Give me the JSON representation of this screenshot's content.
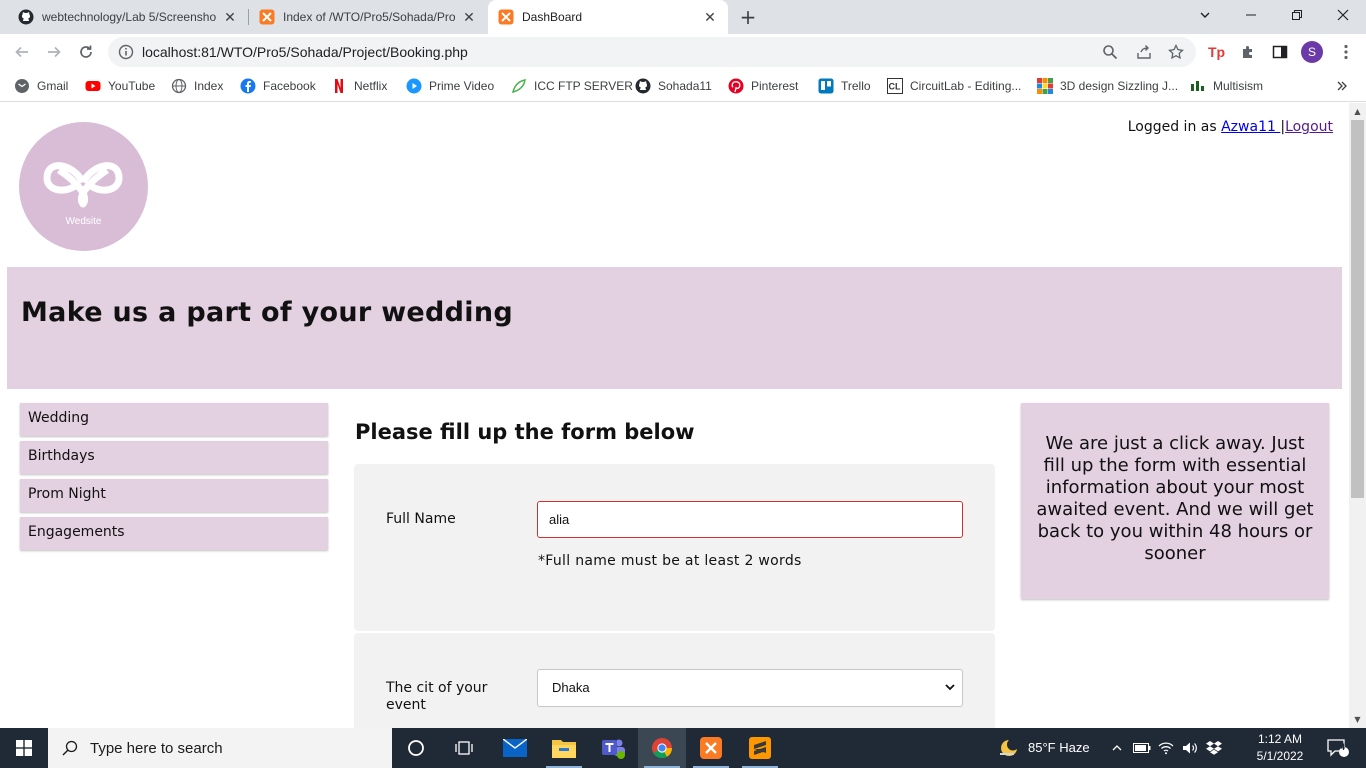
{
  "browser": {
    "tabs": [
      {
        "title": "webtechnology/Lab 5/Screensho",
        "icon": "github-icon"
      },
      {
        "title": "Index of /WTO/Pro5/Sohada/Pro",
        "icon": "xampp-icon"
      },
      {
        "title": "DashBoard",
        "icon": "xampp-icon",
        "active": true
      }
    ],
    "url": "localhost:81/WTO/Pro5/Sohada/Project/Booking.php",
    "profile_initial": "S",
    "bookmarks": [
      {
        "label": "Gmail",
        "icon": "gmail-icon"
      },
      {
        "label": "YouTube",
        "icon": "youtube-icon"
      },
      {
        "label": "Index",
        "icon": "globe-icon"
      },
      {
        "label": "Facebook",
        "icon": "facebook-icon"
      },
      {
        "label": "Netflix",
        "icon": "netflix-icon"
      },
      {
        "label": "Prime Video",
        "icon": "primevideo-icon"
      },
      {
        "label": "ICC FTP SERVER",
        "icon": "leaf-icon"
      },
      {
        "label": "Sohada11",
        "icon": "github-icon"
      },
      {
        "label": "Pinterest",
        "icon": "pinterest-icon"
      },
      {
        "label": "Trello",
        "icon": "trello-icon"
      },
      {
        "label": "CircuitLab - Editing...",
        "icon": "circuitlab-icon"
      },
      {
        "label": "3D design Sizzling J...",
        "icon": "tinkercad-icon"
      },
      {
        "label": "Multisism",
        "icon": "multisim-icon"
      }
    ]
  },
  "page": {
    "logo_text": "Wedsite",
    "login": {
      "prefix": "Logged in as ",
      "user": "Azwa11 ",
      "separator": "|",
      "logout": "Logout"
    },
    "banner_title": "Make us a part of your wedding",
    "nav": [
      "Wedding",
      "Birthdays",
      "Prom Night",
      "Engagements"
    ],
    "form_title": "Please fill up the form below",
    "form": {
      "full_name_label": "Full Name",
      "full_name_value": "alia",
      "full_name_hint": "*Full name must be at least 2 words",
      "city_label": "The cit of your event",
      "city_value": "Dhaka"
    },
    "info_text": "We are just a click away. Just fill up the form with essential information about your most awaited event. And we will get back to you within 48 hours or sooner"
  },
  "taskbar": {
    "search_placeholder": "Type here to search",
    "weather": "85°F  Haze",
    "time": "1:12 AM",
    "date": "5/1/2022",
    "notification_count": "4"
  }
}
